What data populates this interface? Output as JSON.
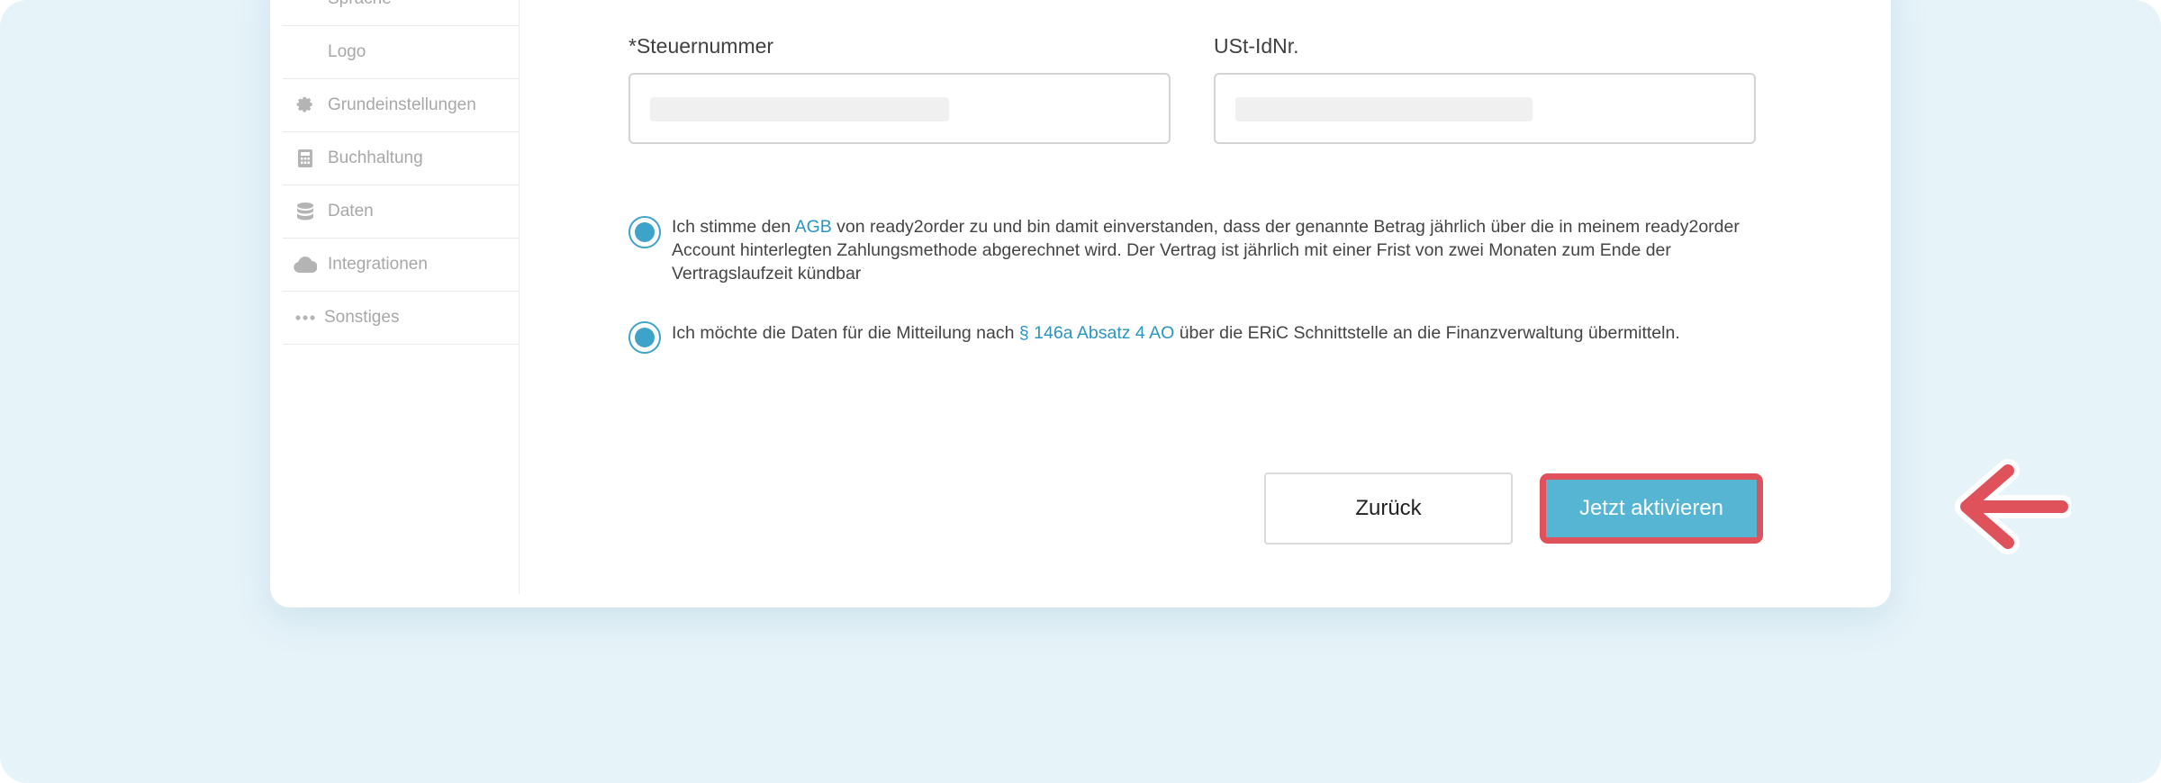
{
  "sidebar": {
    "items": [
      {
        "label": "Sprache",
        "icon": ""
      },
      {
        "label": "Logo",
        "icon": ""
      },
      {
        "label": "Grundeinstellungen",
        "icon": "gear-icon"
      },
      {
        "label": "Buchhaltung",
        "icon": "calculator-icon"
      },
      {
        "label": "Daten",
        "icon": "database-icon"
      },
      {
        "label": "Integrationen",
        "icon": "cloud-icon"
      },
      {
        "label": "Sonstiges",
        "icon": "more-dots-icon"
      }
    ]
  },
  "form": {
    "tax_number_label": "*Steuernummer",
    "tax_number_value": "",
    "vat_id_label": "USt-IdNr.",
    "vat_id_value": ""
  },
  "consents": [
    {
      "checked": true,
      "text_before": "Ich stimme den ",
      "link": "AGB",
      "text_after": " von ready2order zu und bin damit einverstanden, dass der genannte Betrag jährlich über die in meinem ready2order Account hinterlegten Zahlungsmethode abgerechnet wird. Der Vertrag ist jährlich mit einer Frist von zwei Monaten zum Ende der Vertragslaufzeit kündbar"
    },
    {
      "checked": true,
      "text_before": "Ich möchte die Daten für die Mitteilung nach ",
      "link": "§ 146a Absatz 4 AO",
      "text_after": " über die ERiC Schnittstelle an die Finanzverwaltung übermitteln."
    }
  ],
  "buttons": {
    "back_label": "Zurück",
    "activate_label": "Jetzt aktivieren"
  },
  "colors": {
    "accent": "#56b5d3",
    "link": "#2a95c2",
    "highlight": "#e0525b",
    "background": "#e6f3f9"
  }
}
